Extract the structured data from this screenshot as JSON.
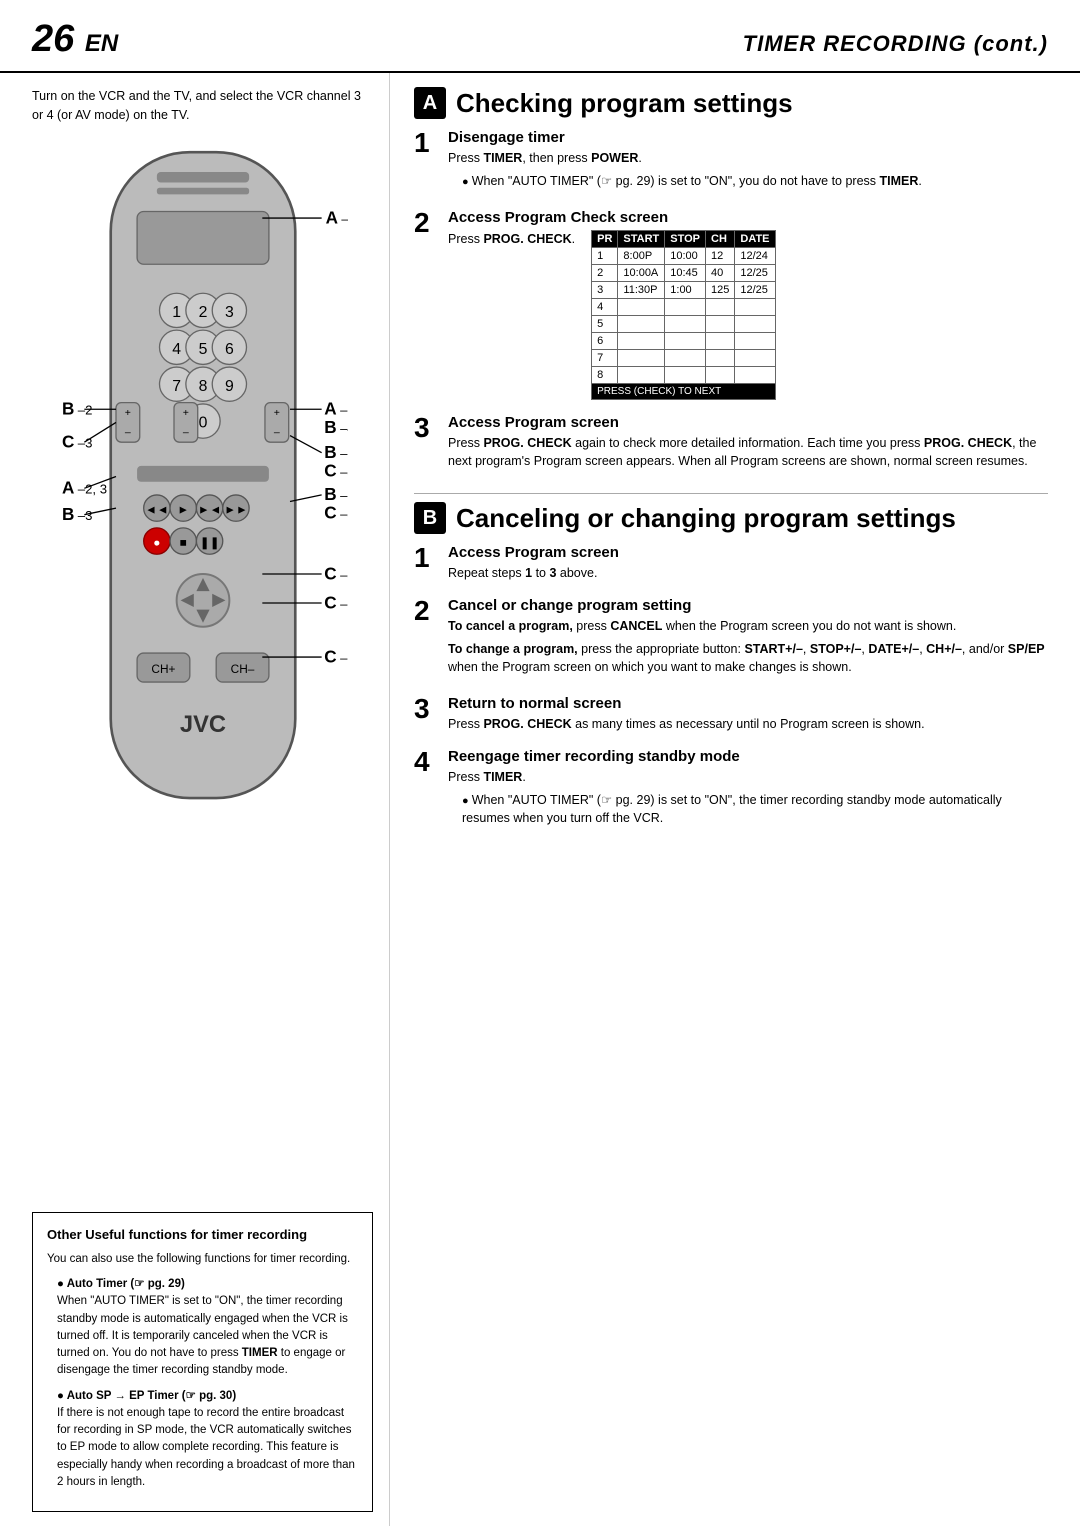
{
  "header": {
    "page_num": "26",
    "page_lang": "EN",
    "title": "TIMER RECORDING (cont.)"
  },
  "left": {
    "intro": "Turn on the VCR and the TV, and select the VCR channel 3 or 4 (or AV mode) on the TV.",
    "bottom_box": {
      "title": "Other Useful functions for timer recording",
      "intro": "You can also use the following functions for timer recording.",
      "items": [
        {
          "title": "● Auto Timer (☞ pg. 29)",
          "body": "When \"AUTO TIMER\" is set to \"ON\", the timer recording standby mode is automatically engaged when the VCR is turned off. It is temporarily canceled when the VCR is turned on. You do not have to press TIMER to engage or disengage the timer recording standby mode."
        },
        {
          "title": "● Auto SP → EP Timer (☞ pg. 30)",
          "body": "If there is not enough tape to record the entire broadcast for recording in SP mode, the VCR automatically switches to EP mode to allow complete recording. This feature is especially handy when recording a broadcast of more than 2 hours in length."
        }
      ]
    }
  },
  "section_a": {
    "badge": "A",
    "title": "Checking program settings",
    "steps": [
      {
        "num": "1",
        "title": "Disengage timer",
        "body_lines": [
          "Press TIMER, then press POWER.",
          "● When \"AUTO TIMER\" (☞ pg. 29) is set to \"ON\", you do not have to press TIMER."
        ]
      },
      {
        "num": "2",
        "title": "Access Program Check screen",
        "body_lines": [
          "Press PROG. CHECK."
        ],
        "table": {
          "headers": [
            "PR",
            "START",
            "STOP",
            "CH",
            "DATE"
          ],
          "rows": [
            [
              "1",
              "8:00P",
              "10:00",
              "12",
              "12/24"
            ],
            [
              "2",
              "10:00A",
              "10:45",
              "40",
              "12/25"
            ],
            [
              "3",
              "11:30P",
              "1:00",
              "125",
              "12/25"
            ],
            [
              "4",
              "",
              "",
              "",
              ""
            ],
            [
              "5",
              "",
              "",
              "",
              ""
            ],
            [
              "6",
              "",
              "",
              "",
              ""
            ],
            [
              "7",
              "",
              "",
              "",
              ""
            ],
            [
              "8",
              "",
              "",
              "",
              ""
            ]
          ],
          "footer": "PRESS (CHECK) TO NEXT"
        }
      },
      {
        "num": "3",
        "title": "Access Program screen",
        "body_lines": [
          "Press PROG. CHECK again to check more detailed information. Each time you press PROG. CHECK, the next program's Program screen appears. When all Program screens are shown, normal screen resumes."
        ]
      }
    ]
  },
  "section_b": {
    "badge": "B",
    "title": "Canceling or changing program settings",
    "steps": [
      {
        "num": "1",
        "title": "Access Program screen",
        "body_lines": [
          "Repeat steps 1 to 3 above."
        ]
      },
      {
        "num": "2",
        "title": "Cancel or change program setting",
        "body_lines": [
          "To cancel a program, press CANCEL when the Program screen you do not want is shown.",
          "To change a program, press the appropriate button: START+/–, STOP+/–, DATE+/–, CH+/–, and/or SP/EP when the Program screen on which you want to make changes is shown."
        ]
      },
      {
        "num": "3",
        "title": "Return to normal screen",
        "body_lines": [
          "Press PROG. CHECK as many times as necessary until no Program screen is shown."
        ]
      },
      {
        "num": "4",
        "title": "Reengage timer recording standby mode",
        "body_lines": [
          "Press TIMER.",
          "● When \"AUTO TIMER\" (☞ pg. 29) is set to \"ON\", the timer recording standby mode automatically resumes when you turn off the VCR."
        ]
      }
    ]
  }
}
